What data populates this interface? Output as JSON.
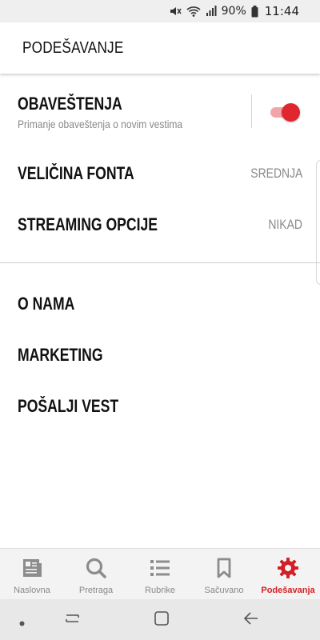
{
  "status_bar": {
    "battery_pct": "90%",
    "time": "11:44"
  },
  "app_bar": {
    "title": "PODEŠAVANJE"
  },
  "settings": {
    "notifications": {
      "label": "OBAVEŠTENJA",
      "sublabel": "Primanje obaveštenja o novim vestima",
      "enabled": true
    },
    "font_size": {
      "label": "VELIČINA FONTA",
      "value": "SREDNJA"
    },
    "streaming": {
      "label": "STREAMING OPCIJE",
      "value": "NIKAD"
    },
    "about": {
      "label": "O NAMA"
    },
    "marketing": {
      "label": "MARKETING"
    },
    "send_news": {
      "label": "POŠALJI VEST"
    }
  },
  "tabs": [
    {
      "label": "Naslovna",
      "icon": "newspaper-icon",
      "active": false
    },
    {
      "label": "Pretraga",
      "icon": "search-icon",
      "active": false
    },
    {
      "label": "Rubrike",
      "icon": "list-icon",
      "active": false
    },
    {
      "label": "Sačuvano",
      "icon": "bookmark-icon",
      "active": false
    },
    {
      "label": "Podešavanja",
      "icon": "gear-icon",
      "active": true
    }
  ],
  "colors": {
    "accent": "#d21f26",
    "toggle_track": "#f2a5a9",
    "muted_text": "#888888"
  }
}
